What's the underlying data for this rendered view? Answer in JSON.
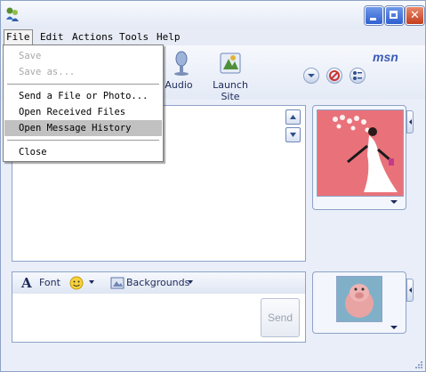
{
  "window": {
    "min_icon": "minimize-icon",
    "max_icon": "maximize-icon",
    "close_icon": "close-icon",
    "close_glyph": "✕"
  },
  "menubar": {
    "items": [
      {
        "label": "File"
      },
      {
        "label": "Edit"
      },
      {
        "label": "Actions"
      },
      {
        "label": "Tools"
      },
      {
        "label": "Help"
      }
    ]
  },
  "file_menu": {
    "items": [
      {
        "label": "Save",
        "enabled": false
      },
      {
        "label": "Save as...",
        "enabled": false
      },
      {
        "label": "Send a File or Photo...",
        "enabled": true
      },
      {
        "label": "Open Received Files",
        "enabled": true
      },
      {
        "label": "Open Message History",
        "enabled": true,
        "highlighted": true
      },
      {
        "label": "Close",
        "enabled": true
      }
    ]
  },
  "toolbar": {
    "audio_label": "Audio",
    "launch_site_label": "Launch Site",
    "brand": "msn"
  },
  "compose": {
    "font_label": "Font",
    "backgrounds_label": "Backgrounds",
    "send_label": "Send"
  },
  "colors": {
    "accent": "#3a5bb8",
    "menu_highlight": "#c1c1c1",
    "photo_bg": "#e9727a"
  }
}
